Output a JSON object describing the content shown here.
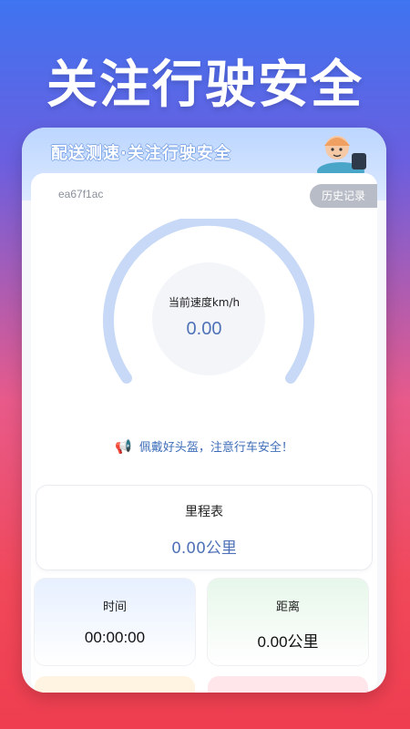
{
  "promo": {
    "headline": "关注行驶安全"
  },
  "banner": {
    "slogan": "配送测速·关注行驶安全"
  },
  "device": {
    "id": "ea67f1ac"
  },
  "header": {
    "history_label": "历史记录"
  },
  "speedometer": {
    "label": "当前速度km/h",
    "value": "0.00"
  },
  "tip": {
    "text": "佩戴好头盔，注意行车安全！"
  },
  "odometer": {
    "title": "里程表",
    "value": "0.00公里"
  },
  "stats": {
    "time": {
      "title": "时间",
      "value": "00:00:00"
    },
    "distance": {
      "title": "距离",
      "value": "0.00公里"
    }
  },
  "colors": {
    "accent": "#4f72b8",
    "gauge_arc": "#c7d9f6",
    "history_button": "#b8bcc6"
  },
  "icons": {
    "tip": "megaphone-icon",
    "rider": "courier-rider-illustration"
  }
}
